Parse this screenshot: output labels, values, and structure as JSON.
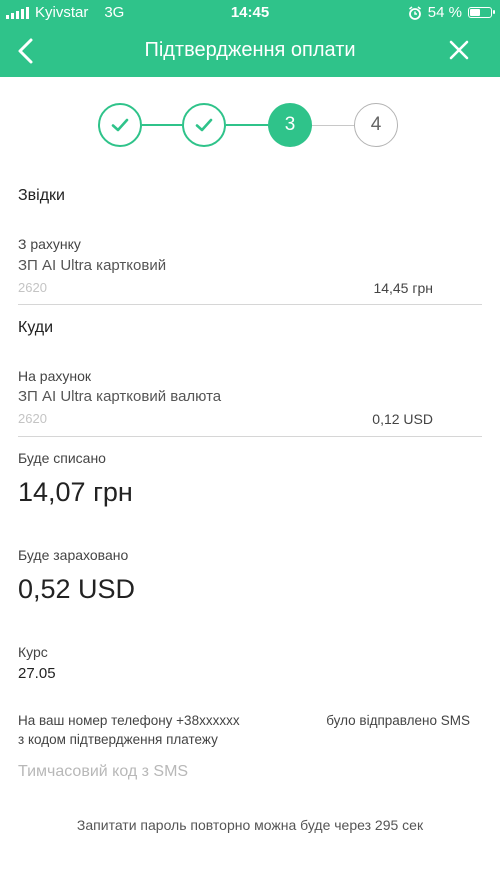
{
  "status": {
    "carrier": "Kyivstar",
    "network": "3G",
    "time": "14:45",
    "battery": "54 %",
    "battery_level": 0.54
  },
  "nav": {
    "title": "Підтвердження оплати",
    "back_icon": "chevron-left-icon",
    "close_icon": "close-icon"
  },
  "stepper": {
    "steps": [
      {
        "label": "",
        "state": "done"
      },
      {
        "label": "",
        "state": "done"
      },
      {
        "label": "3",
        "state": "active"
      },
      {
        "label": "4",
        "state": "todo"
      }
    ]
  },
  "from": {
    "section_title": "Звідки",
    "label": "З рахунку",
    "account_name": "ЗП AI Ultra картковий",
    "account_number": "2620",
    "balance": "14,45 грн"
  },
  "to": {
    "section_title": "Куди",
    "label": "На рахунок",
    "account_name": "ЗП AI Ultra картковий валюта",
    "account_number": "2620",
    "balance": "0,12 USD"
  },
  "debit": {
    "label": "Буде списано",
    "amount": "14,07 грн"
  },
  "credit": {
    "label": "Буде зараховано",
    "amount": "0,52 USD"
  },
  "rate": {
    "label": "Курс",
    "value": "27.05"
  },
  "sms": {
    "line1_left": "На ваш номер телефону +38xxxxxx",
    "line1_right": "було відправлено SMS",
    "line2": "з кодом підтвердження платежу",
    "code_placeholder": "Тимчасовий код з SMS",
    "resend_text": "Запитати пароль повторно можна буде через 295 сек"
  },
  "colors": {
    "accent": "#2fc38a",
    "divider": "#d6d6d6"
  }
}
